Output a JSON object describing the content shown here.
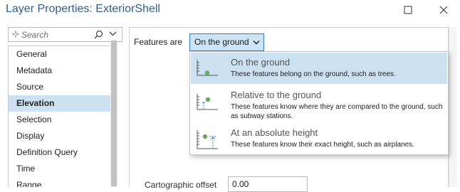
{
  "window": {
    "title": "Layer Properties: ExteriorShell"
  },
  "search": {
    "placeholder": "Search"
  },
  "nav": {
    "items": [
      {
        "label": "General"
      },
      {
        "label": "Metadata"
      },
      {
        "label": "Source"
      },
      {
        "label": "Elevation",
        "selected": true
      },
      {
        "label": "Selection"
      },
      {
        "label": "Display"
      },
      {
        "label": "Definition Query"
      },
      {
        "label": "Time"
      },
      {
        "label": "Range"
      }
    ]
  },
  "elevation": {
    "features_label": "Features are",
    "features_value": "On the ground",
    "options": [
      {
        "title": "On the ground",
        "description": "These features belong on the ground, such as trees.",
        "icon": "on-ground-icon",
        "selected": true
      },
      {
        "title": "Relative to the ground",
        "description": "These features know where they are compared to the ground, such as subway stations.",
        "icon": "relative-to-ground-icon"
      },
      {
        "title": "At an absolute height",
        "description": "These features know their exact height, such as airplanes.",
        "icon": "absolute-height-icon"
      }
    ],
    "cartographic_offset_label": "Cartographic offset",
    "cartographic_offset_value": "0.00"
  },
  "colors": {
    "title": "#2e5f8f",
    "selection": "#cce1f2",
    "accent_border": "#2f7fc4"
  }
}
